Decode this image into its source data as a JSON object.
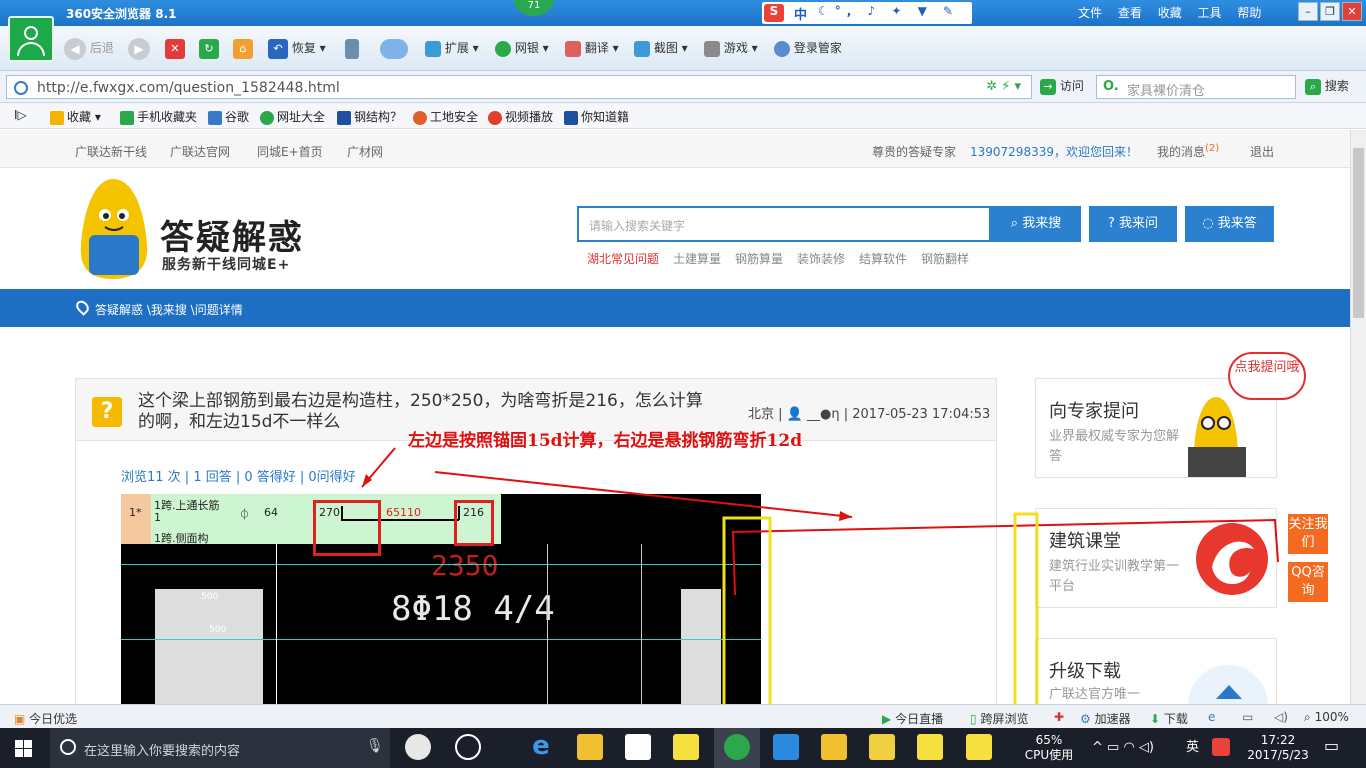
{
  "browser": {
    "title": "360安全浏览器 8.1",
    "badge": "71",
    "ime": {
      "brand": "S",
      "lang": "中",
      "glyphs": "☾°, ♪ ✦ ▼ ✎"
    },
    "menus": [
      "文件",
      "查看",
      "收藏",
      "工具",
      "帮助"
    ],
    "toolbar": {
      "back": "后退",
      "restore": "恢复",
      "extend": "扩展",
      "bank": "网银",
      "translate": "翻译",
      "screenshot": "截图",
      "games": "游戏",
      "login_manager": "登录管家"
    },
    "url": "http://e.fwxgx.com/question_1582448.html",
    "go_label": "访问",
    "search_placeholder": "家具裸价清仓",
    "search_label": "搜索",
    "favorites": [
      {
        "label": "收藏",
        "color": "#f3b400"
      },
      {
        "label": "手机收藏夹",
        "color": "#2aa84a"
      },
      {
        "label": "谷歌",
        "color": "#3a78c8"
      },
      {
        "label": "网址大全",
        "color": "#2aa84a"
      },
      {
        "label": "钢结构？",
        "color": "#1f4fa0"
      },
      {
        "label": "工地安全",
        "color": "#e0602a"
      },
      {
        "label": "视频播放",
        "color": "#e0402a"
      },
      {
        "label": "你知道籍",
        "color": "#1f4fa0"
      }
    ]
  },
  "site": {
    "topnav": [
      "广联达新干线",
      "广联达官网",
      "同城E+首页",
      "广材网"
    ],
    "expert_label": "尊贵的答疑专家",
    "welcome": "13907298339，欢迎您回来！",
    "messages": "我的消息",
    "messages_count": "(2)",
    "logout": "退出",
    "logo_title": "答疑解惑",
    "logo_sub": "服务新干线同城E+",
    "search_placeholder": "请输入搜索关键字",
    "btn_search": "我来搜",
    "btn_ask": "我来问",
    "btn_answer": "我来答",
    "hot_tags": [
      "湖北常见问题",
      "土建算量",
      "钢筋算量",
      "装饰装修",
      "结算软件",
      "钢筋翻样"
    ],
    "breadcrumb": "答疑解惑 \\我来搜 \\问题详情",
    "question": {
      "title": "这个梁上部钢筋到最右边是构造柱，250*250，为啥弯折是216，怎么计算的啊，和左边15d不一样么",
      "location": "北京",
      "user": "__●η",
      "time": "2017-05-23 17:04:53",
      "stats": "浏览11 次 | 1 回答 | 0 答得好 | 0问得好"
    },
    "annotation": "左边是按照锚固15d计算，右边是悬挑钢筋弯折12d",
    "cad": {
      "row_no": "1*",
      "row_label": "1跨.上通长筋1",
      "row_label2": "1跨.侧面构",
      "grade": "⏀",
      "count": "64",
      "left_bend": "270",
      "length": "65110",
      "right_bend": "216",
      "dim_big": "2350",
      "rebar": "8Φ18 4/4",
      "dim_small1": "500",
      "dim_small2": "500"
    },
    "side": {
      "ask_title": "向专家提问",
      "ask_desc": "业界最权威专家为您解答",
      "bubble": "点我提问哦",
      "class_title": "建筑课堂",
      "class_desc": "建筑行业实训教学第一平台",
      "download_title": "升级下载",
      "download_desc": "广联达官方唯一"
    },
    "float": {
      "follow": "关注我们",
      "qq": "QQ咨询"
    }
  },
  "statusbar": {
    "today_pick": "今日优选",
    "live": "今日直播",
    "cross_screen": "跨屏浏览",
    "accelerator": "加速器",
    "download": "下载",
    "zoom": "100%"
  },
  "taskbar": {
    "search_placeholder": "在这里输入你要搜索的内容",
    "cpu_percent": "65%",
    "cpu_label": "CPU使用",
    "ime_lang": "英",
    "time": "17:22",
    "date": "2017/5/23"
  },
  "colors": {
    "brand_blue": "#1e6fc4",
    "orange": "#f26b21",
    "annotation_red": "#e01010"
  }
}
